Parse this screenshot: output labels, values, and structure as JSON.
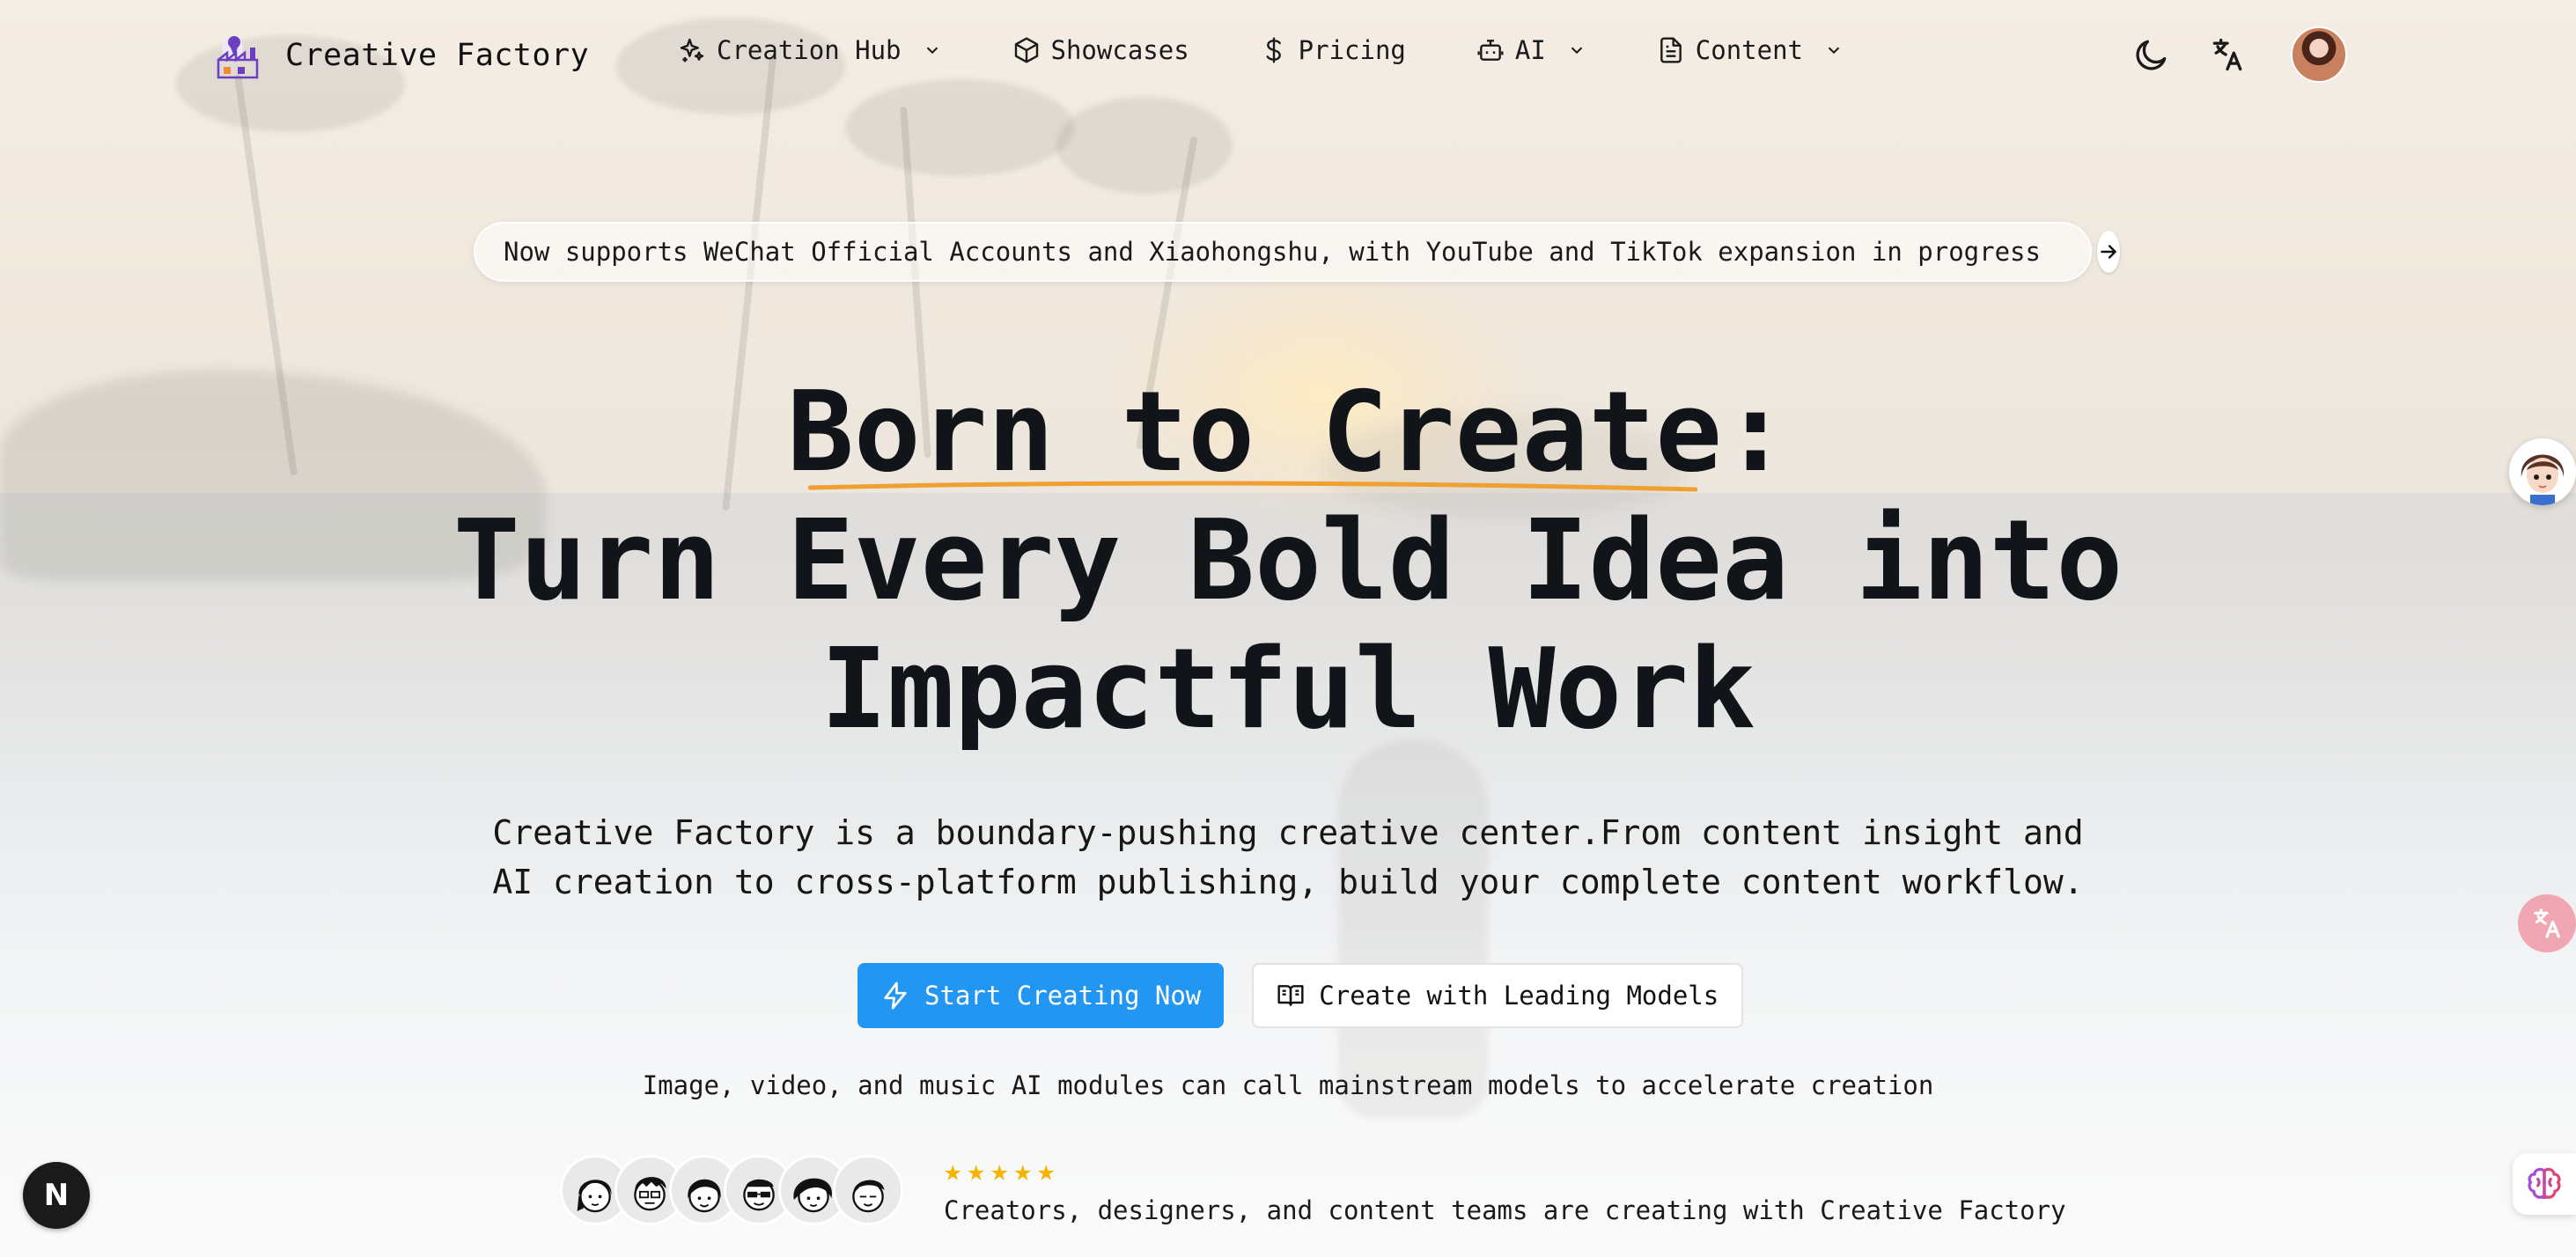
{
  "brand": {
    "name": "Creative Factory"
  },
  "nav": {
    "items": [
      {
        "label": "Creation Hub",
        "icon": "sparkles-icon",
        "has_dropdown": true
      },
      {
        "label": "Showcases",
        "icon": "cube-icon",
        "has_dropdown": false
      },
      {
        "label": "Pricing",
        "icon": "dollar-icon",
        "has_dropdown": false
      },
      {
        "label": "AI",
        "icon": "robot-icon",
        "has_dropdown": true
      },
      {
        "label": "Content",
        "icon": "document-icon",
        "has_dropdown": true
      }
    ],
    "right": {
      "theme_icon": "moon-icon",
      "language_icon": "translate-icon",
      "avatar": "user-avatar"
    }
  },
  "announcement": {
    "text": "Now supports WeChat Official Accounts and Xiaohongshu, with YouTube and TikTok expansion in progress",
    "icon": "arrow-right-icon"
  },
  "hero": {
    "line1": "Born to Create:",
    "line2": "Turn Every Bold Idea into",
    "line3": "Impactful Work",
    "underline_color": "#f0a030",
    "description_line1": "Creative Factory is a boundary-pushing creative center.From content insight and",
    "description_line2": "AI creation to cross-platform publishing, build your complete content workflow."
  },
  "cta": {
    "primary_label": "Start Creating Now",
    "primary_icon": "lightning-icon",
    "primary_color": "#2196f3",
    "secondary_label": "Create with Leading Models",
    "secondary_icon": "book-open-icon"
  },
  "sub_note": "Image, video, and music AI modules can call mainstream models to accelerate creation",
  "social_proof": {
    "rating_stars": 5,
    "star_color": "#f6b400",
    "caption": "Creators, designers, and content teams are creating with Creative Factory",
    "avatar_count": 6
  },
  "floating": {
    "next_badge": "N",
    "assistant_icon": "assistant-avatar-icon",
    "translate_icon": "translate-float-icon",
    "brain_icon": "brain-icon"
  }
}
